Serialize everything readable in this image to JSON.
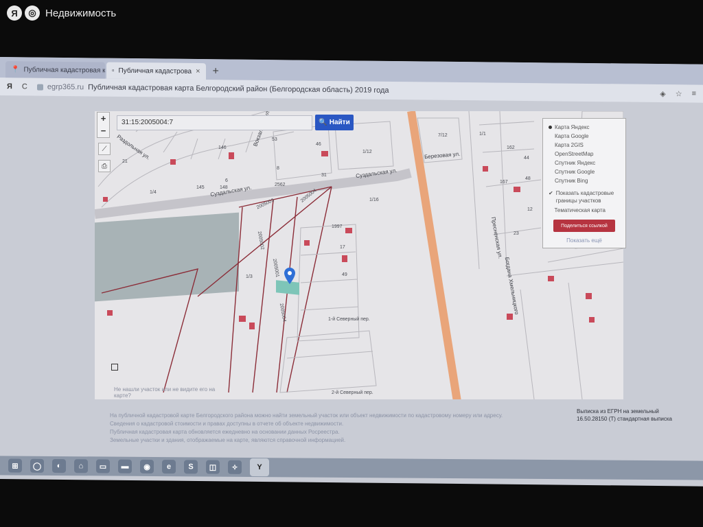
{
  "watermark": {
    "logo": "Я",
    "text": "Недвижимость"
  },
  "browser": {
    "tabs": [
      {
        "label": "Публичная кадастровая ка",
        "active": false
      },
      {
        "label": "Публичная кадастрова",
        "active": true
      }
    ],
    "new_tab": "+",
    "close": "×",
    "toolbar": {
      "y_logo": "Я",
      "reload": "C",
      "domain": "egrp365.ru",
      "page_title": "Публичная кадастровая карта Белгородский район (Белгородская область) 2019 года"
    }
  },
  "search": {
    "value": "31:15:2005004:7",
    "button_label": "Найти",
    "button_icon": "search-icon"
  },
  "map_controls": {
    "zoom_in": "+",
    "zoom_out": "−"
  },
  "layers_panel": {
    "options": [
      {
        "label": "Карта Яндекс",
        "selected": true
      },
      {
        "label": "Карта Google",
        "selected": false
      },
      {
        "label": "Карта 2GIS",
        "selected": false
      },
      {
        "label": "OpenStreetMap",
        "selected": false
      },
      {
        "label": "Спутник Яндекс",
        "selected": false
      },
      {
        "label": "Спутник Google",
        "selected": false
      },
      {
        "label": "Спутник Bing",
        "selected": false
      }
    ],
    "checkbox_1": "Показать кадастровые границы участков",
    "checkbox_2": "Тематическая карта",
    "share_button": "Поделиться ссылкой",
    "more_link": "Показать ещё"
  },
  "map_labels": {
    "street_suzdal_1": "Суздальская ул.",
    "street_suzdal_2": "Суздальская ул.",
    "street_berezovaya": "Березовая ул.",
    "street_razdolnaya": "Раздольная ул.",
    "street_vokzalnaya": "Вокзальная ул.",
    "street_presnaya": "Пресненская ул.",
    "street_bogdana": "Богдана Хмельницкого",
    "lane_severny": "1-й Северный пер.",
    "lane_severny_2": "2-й Северный пер.",
    "parcel_ids": [
      "2005004",
      "2005003",
      "2005002",
      "2005001",
      "2005004"
    ],
    "plot_numbers": [
      "53",
      "46",
      "1/12",
      "8",
      "7/12",
      "1/1",
      "162",
      "21",
      "6",
      "1/3",
      "146",
      "31",
      "17",
      "2562",
      "1/16",
      "49",
      "145",
      "148",
      "1/4",
      "167",
      "44",
      "12",
      "48",
      "23",
      "1997"
    ]
  },
  "notice": "Не нашли участок или не видите его на карте?",
  "footer_lines": [
    "На публичной кадастровой карте Белгородского района можно найти земельный участок или объект недвижимости по кадастровому номеру или адресу.",
    "Сведения о кадастровой стоимости и правах доступны в отчете об объекте недвижимости.",
    "Публичная кадастровая карта обновляется ежедневно на основании данных Росреестра.",
    "Земельные участки и здания, отображаемые на карте, являются справочной информацией."
  ],
  "side_note": {
    "line1": "Выписка из ЕГРН на земельный",
    "line2": "16.50.28150 (Т) стандартная выписка"
  },
  "taskbar": {
    "icons": [
      "start-icon",
      "search-icon",
      "edge-icon",
      "settings-icon",
      "explorer-icon",
      "mail-icon",
      "chrome-icon",
      "ie-icon",
      "skype-icon",
      "store-icon",
      "photos-icon",
      "yandex-icon"
    ],
    "active_label": "Y"
  },
  "colors": {
    "find_button": "#2a57c3",
    "share_button": "#b63440",
    "parcel_line": "#8b2c37",
    "building": "#c94a5a",
    "road_orange": "#e9a57a"
  }
}
